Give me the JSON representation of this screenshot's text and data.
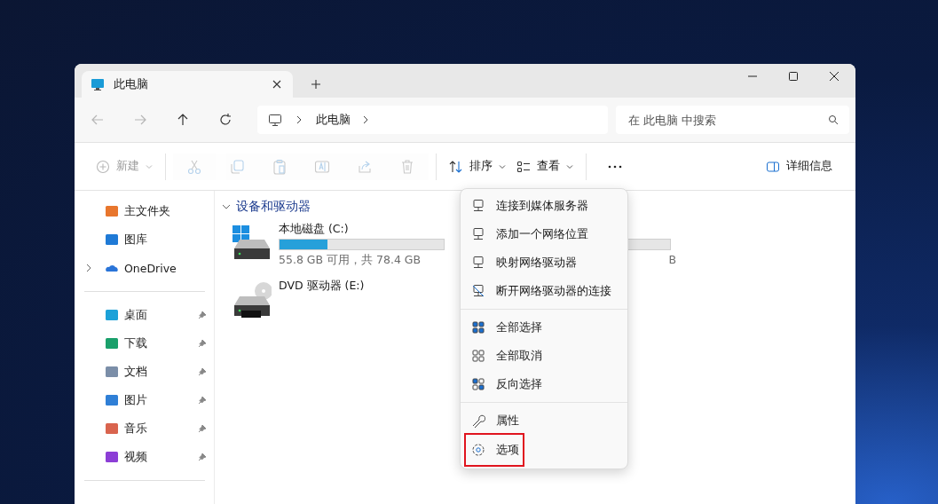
{
  "tab": {
    "title": "此电脑",
    "selected": true
  },
  "nav": [
    {
      "disabled": true
    },
    {
      "disabled": true
    },
    {
      "disabled": false
    },
    {
      "disabled": false
    }
  ],
  "address": {
    "crumbs": [
      "此电脑"
    ]
  },
  "search": {
    "placeholder": "在 此电脑 中搜索"
  },
  "toolbar": [
    {
      "kind": "labeled",
      "label": "新建",
      "disabled": true,
      "dropdown": true
    },
    {
      "kind": "separator"
    },
    {
      "kind": "icon",
      "disabled": true
    },
    {
      "kind": "icon",
      "disabled": true
    },
    {
      "kind": "icon",
      "disabled": true
    },
    {
      "kind": "icon",
      "disabled": true
    },
    {
      "kind": "icon",
      "disabled": true
    },
    {
      "kind": "icon",
      "disabled": true
    },
    {
      "kind": "separator"
    },
    {
      "kind": "labeled",
      "label": "排序",
      "disabled": false,
      "dropdown": true
    },
    {
      "kind": "labeled",
      "label": "查看",
      "disabled": false,
      "dropdown": true
    },
    {
      "kind": "separator"
    },
    {
      "kind": "more"
    }
  ],
  "details_button": {
    "label": "详细信息"
  },
  "sidebar": {
    "groups": [
      {
        "items": [
          {
            "label": "主文件夹",
            "pinned": false
          },
          {
            "label": "图库",
            "pinned": false
          },
          {
            "label": "OneDrive",
            "pinned": false,
            "expanded": false
          }
        ]
      },
      {
        "items": [
          {
            "label": "桌面",
            "pinned": true
          },
          {
            "label": "下载",
            "pinned": true
          },
          {
            "label": "文档",
            "pinned": true
          },
          {
            "label": "图片",
            "pinned": true
          },
          {
            "label": "音乐",
            "pinned": true
          },
          {
            "label": "视频",
            "pinned": true
          }
        ]
      }
    ]
  },
  "section": {
    "title": "设备和驱动器",
    "expanded": true
  },
  "drives": [
    {
      "kind": "disk",
      "name": "本地磁盘 (C:)",
      "level": 0.29,
      "usage": "55.8 GB 可用，共 78.4 GB"
    },
    {
      "kind": "partial",
      "usage": "B"
    },
    {
      "kind": "dvd",
      "name": "DVD 驱动器 (E:)"
    }
  ],
  "menu": {
    "groups": [
      {
        "items": [
          {
            "label": "连接到媒体服务器",
            "highlighted": false
          },
          {
            "label": "添加一个网络位置",
            "highlighted": false
          },
          {
            "label": "映射网络驱动器",
            "highlighted": false
          },
          {
            "label": "断开网络驱动器的连接",
            "highlighted": false
          }
        ]
      },
      {
        "items": [
          {
            "label": "全部选择",
            "highlighted": false
          },
          {
            "label": "全部取消",
            "highlighted": false
          },
          {
            "label": "反向选择",
            "highlighted": false
          }
        ]
      },
      {
        "items": [
          {
            "label": "属性",
            "highlighted": false
          },
          {
            "label": "选项",
            "highlighted": true
          }
        ]
      }
    ]
  }
}
